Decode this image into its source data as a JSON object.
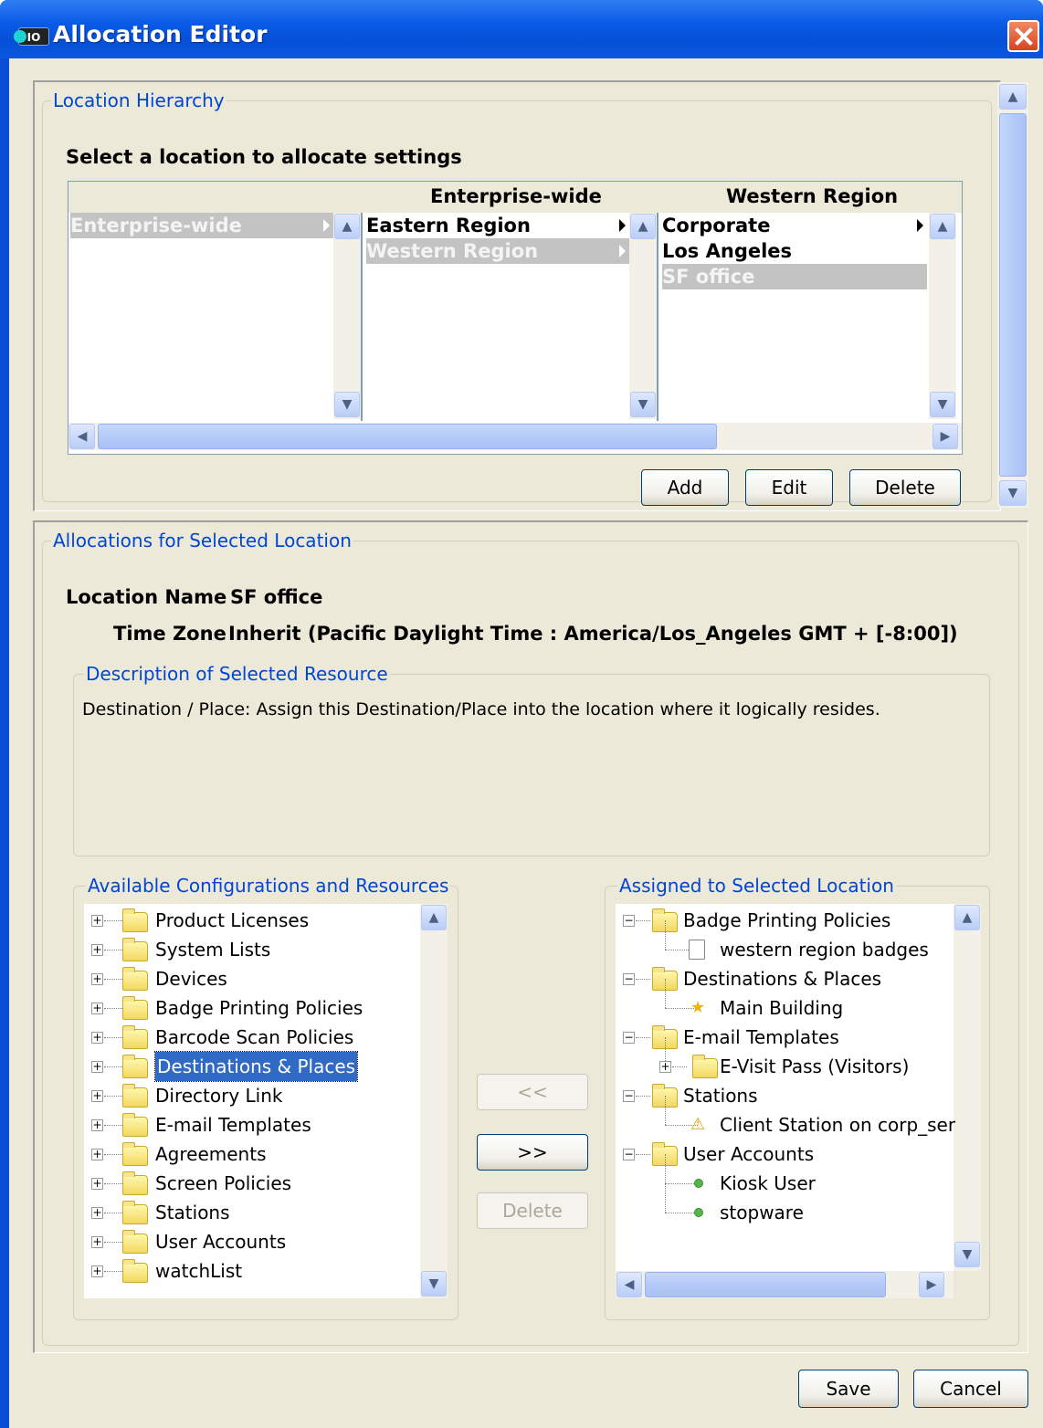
{
  "window": {
    "title": "Allocation Editor",
    "icon": "app-icon",
    "icon_text": "IO"
  },
  "location_hierarchy": {
    "group_title": "Location Hierarchy",
    "instruction": "Select a location to allocate settings",
    "column_headers": [
      "Enterprise-wide",
      "Western Region"
    ],
    "columns": [
      {
        "items": [
          {
            "label": "Enterprise-wide",
            "selected": true,
            "has_children": true
          }
        ]
      },
      {
        "items": [
          {
            "label": "Eastern Region",
            "selected": false,
            "has_children": true
          },
          {
            "label": "Western Region",
            "selected": true,
            "has_children": true
          }
        ]
      },
      {
        "items": [
          {
            "label": "Corporate",
            "selected": false,
            "has_children": true
          },
          {
            "label": "Los Angeles",
            "selected": false,
            "has_children": false
          },
          {
            "label": "SF office",
            "selected": true,
            "has_children": false
          }
        ]
      }
    ],
    "buttons": {
      "add": "Add",
      "edit": "Edit",
      "delete": "Delete"
    }
  },
  "allocations": {
    "group_title": "Allocations for Selected Location",
    "location_name_label": "Location Name",
    "location_name_value": "SF office",
    "time_zone_label": "Time Zone",
    "time_zone_value": "Inherit (Pacific Daylight Time : America/Los_Angeles GMT + [-8:00])",
    "description_title": "Description of Selected Resource",
    "description_text": "Destination / Place: Assign this Destination/Place into the location where it logically resides.",
    "available": {
      "group_title": "Available Configurations and Resources",
      "items": [
        "Product Licenses",
        "System Lists",
        "Devices",
        "Badge Printing Policies",
        "Barcode Scan Policies",
        "Destinations & Places",
        "Directory Link",
        "E-mail Templates",
        "Agreements",
        "Screen Policies",
        "Stations",
        "User Accounts",
        "watchList"
      ],
      "selected_index": 5
    },
    "transfer_buttons": {
      "remove": "<<",
      "add": ">>",
      "delete": "Delete"
    },
    "assigned": {
      "group_title": "Assigned to Selected Location",
      "nodes": [
        {
          "label": "Badge Printing Policies",
          "level": 0,
          "icon": "folder-open-icon",
          "expander": "−"
        },
        {
          "label": "western region badges",
          "level": 1,
          "icon": "document-add-icon"
        },
        {
          "label": "Destinations & Places",
          "level": 0,
          "icon": "folder-open-icon",
          "expander": "−"
        },
        {
          "label": "Main Building",
          "level": 1,
          "icon": "star-icon"
        },
        {
          "label": "E-mail Templates",
          "level": 0,
          "icon": "folder-open-icon",
          "expander": "−"
        },
        {
          "label": "E-Visit Pass (Visitors)",
          "level": 1,
          "icon": "folder-icon",
          "expander": "+"
        },
        {
          "label": "Stations",
          "level": 0,
          "icon": "folder-open-icon",
          "expander": "−"
        },
        {
          "label": "Client Station on corp_ser",
          "level": 1,
          "icon": "warning-icon"
        },
        {
          "label": "User Accounts",
          "level": 0,
          "icon": "folder-open-icon",
          "expander": "−"
        },
        {
          "label": "Kiosk User",
          "level": 1,
          "icon": "status-dot-icon"
        },
        {
          "label": "stopware",
          "level": 1,
          "icon": "status-dot-icon"
        }
      ]
    }
  },
  "footer": {
    "save": "Save",
    "cancel": "Cancel"
  }
}
